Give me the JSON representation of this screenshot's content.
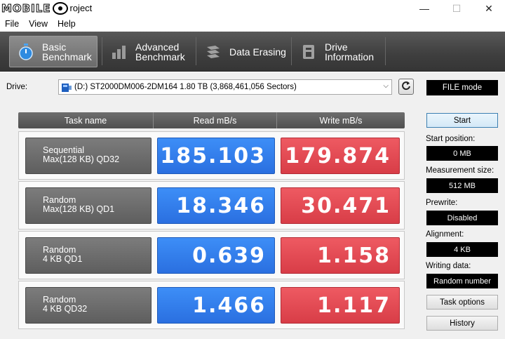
{
  "window": {
    "logo_text": "MOBILE",
    "title_suffix": "roject",
    "controls": {
      "minimize": "—",
      "maximize": "☐",
      "close": "✕"
    }
  },
  "menu": [
    "File",
    "View",
    "Help"
  ],
  "toolbar": [
    {
      "line1": "Basic",
      "line2": "Benchmark",
      "icon": "stopwatch-icon",
      "active": true
    },
    {
      "line1": "Advanced",
      "line2": "Benchmark",
      "icon": "bar-chart-icon",
      "active": false
    },
    {
      "line1": "Data Erasing",
      "line2": "",
      "icon": "erase-icon",
      "active": false
    },
    {
      "line1": "Drive",
      "line2": "Information",
      "icon": "drive-info-icon",
      "active": false
    }
  ],
  "drive": {
    "label": "Drive:",
    "selected": "(D:) ST2000DM006-2DM164  1.80 TB (3,868,461,056 Sectors)"
  },
  "file_mode": "FILE mode",
  "table": {
    "headers": [
      "Task name",
      "Read mB/s",
      "Write mB/s"
    ],
    "rows": [
      {
        "task_line1": "Sequential",
        "task_line2": "Max(128 KB) QD32",
        "read": "185.103",
        "write": "179.874"
      },
      {
        "task_line1": "Random",
        "task_line2": "Max(128 KB) QD1",
        "read": "18.346",
        "write": "30.471"
      },
      {
        "task_line1": "Random",
        "task_line2": "4 KB QD1",
        "read": "0.639",
        "write": "1.158"
      },
      {
        "task_line1": "Random",
        "task_line2": "4 KB QD32",
        "read": "1.466",
        "write": "1.117"
      }
    ]
  },
  "side": {
    "start": "Start",
    "start_position_label": "Start position:",
    "start_position": "0 MB",
    "measurement_size_label": "Measurement size:",
    "measurement_size": "512 MB",
    "prewrite_label": "Prewrite:",
    "prewrite": "Disabled",
    "alignment_label": "Alignment:",
    "alignment": "4 KB",
    "writing_data_label": "Writing data:",
    "writing_data": "Random number",
    "task_options": "Task options",
    "history": "History"
  },
  "colors": {
    "read": "#2f7ae8",
    "write": "#e04a53",
    "toolbar": "#454545"
  }
}
